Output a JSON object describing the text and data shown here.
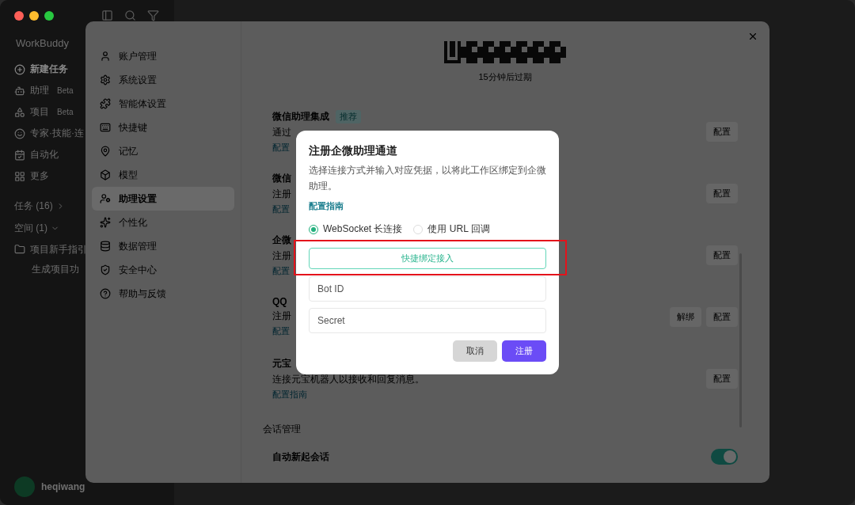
{
  "sidebar": {
    "brand": "WorkBuddy",
    "nav": [
      {
        "label": "新建任务",
        "selected": true
      },
      {
        "label": "助理",
        "badge": "Beta",
        "selected": false
      },
      {
        "label": "项目",
        "badge": "Beta",
        "selected": false
      },
      {
        "label": "专家·技能·连",
        "selected": false
      },
      {
        "label": "自动化",
        "selected": false
      },
      {
        "label": "更多",
        "selected": false
      }
    ],
    "groups": [
      {
        "label": "任务 (16)",
        "expanded": false
      },
      {
        "label": "空间 (1)",
        "expanded": true
      }
    ],
    "projects": [
      {
        "label": "项目新手指引",
        "children": [
          {
            "label": "生成项目功"
          }
        ]
      }
    ],
    "user": {
      "name": "heqiwang"
    }
  },
  "settings": {
    "menu": [
      {
        "label": "账户管理",
        "selected": false
      },
      {
        "label": "系统设置",
        "selected": false
      },
      {
        "label": "智能体设置",
        "selected": false
      },
      {
        "label": "快捷键",
        "selected": false
      },
      {
        "label": "记忆",
        "selected": false
      },
      {
        "label": "模型",
        "selected": false
      },
      {
        "label": "助理设置",
        "selected": true
      },
      {
        "label": "个性化",
        "selected": false
      },
      {
        "label": "数据管理",
        "selected": false
      },
      {
        "label": "安全中心",
        "selected": false
      },
      {
        "label": "帮助与反馈",
        "selected": false
      }
    ],
    "qr_caption": "15分钟后过期",
    "integrations": [
      {
        "title": "微信助理集成",
        "badge": "推荐",
        "description": "通过",
        "link": "配置",
        "actions": [
          "配置"
        ]
      },
      {
        "title": "微信",
        "description": "注册",
        "link": "配置",
        "actions": [
          "配置"
        ]
      },
      {
        "title": "企微",
        "description": "注册",
        "link": "配置",
        "actions": [
          "配置"
        ]
      },
      {
        "title": "QQ",
        "description": "注册",
        "link": "配置",
        "actions": [
          "解绑",
          "配置"
        ]
      },
      {
        "title": "元宝",
        "description": "连接元宝机器人以接收和回复消息。",
        "link": "配置指南",
        "actions": [
          "配置"
        ]
      }
    ],
    "section": "会话管理",
    "toggles": [
      {
        "label": "自动新起会话",
        "on": true
      }
    ]
  },
  "dialog": {
    "title": "注册企微助理通道",
    "description": "选择连接方式并输入对应凭据，以将此工作区绑定到企微助理。",
    "link": "配置指南",
    "modes": [
      {
        "label": "WebSocket 长连接",
        "selected": true
      },
      {
        "label": "使用 URL 回调",
        "selected": false
      }
    ],
    "quick_bind": "快捷绑定接入",
    "fields": [
      {
        "placeholder": "Bot ID"
      },
      {
        "placeholder": "Secret"
      }
    ],
    "buttons": [
      {
        "label": "取消",
        "kind": "secondary"
      },
      {
        "label": "注册",
        "kind": "primary"
      }
    ]
  }
}
